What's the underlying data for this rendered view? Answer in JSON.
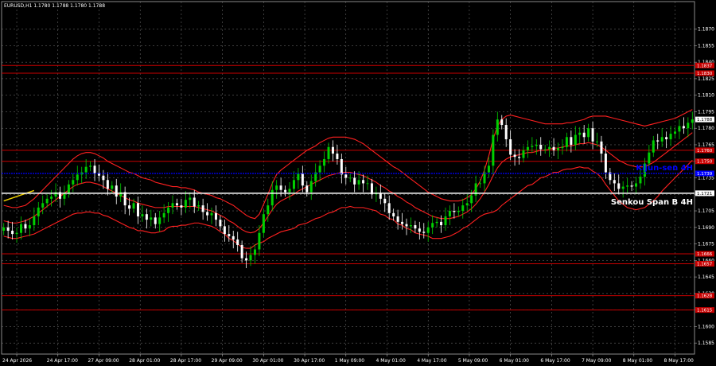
{
  "chart_data": {
    "type": "line",
    "symbol_header": "EURUSD,H1  1.1780 1.1788 1.1780 1.1788",
    "ylim": [
      1.1575,
      1.1895
    ],
    "y_ticks": [
      1.1585,
      1.16,
      1.1615,
      1.163,
      1.1645,
      1.166,
      1.1675,
      1.169,
      1.1705,
      1.172,
      1.1735,
      1.175,
      1.1765,
      1.178,
      1.1795,
      1.181,
      1.1825,
      1.184,
      1.1855,
      1.187
    ],
    "x_ticks": [
      "24 Apr 2026",
      "24 Apr 17:00",
      "27 Apr 09:00",
      "28 Apr 01:00",
      "28 Apr 17:00",
      "29 Apr 09:00",
      "30 Apr 01:00",
      "30 Apr 17:00",
      "1 May 09:00",
      "4 May 01:00",
      "4 May 17:00",
      "5 May 09:00",
      "6 May 01:00",
      "6 May 17:00",
      "7 May 09:00",
      "8 May 01:00",
      "8 May 17:00"
    ],
    "bars_count": 160,
    "last_price": 1.1788,
    "colors": {
      "bull": "#00d000",
      "bear": "#ffffff",
      "band": "#ff2020",
      "level": "#c80000",
      "kijun": "#0000ff",
      "senkou": "#ffffff",
      "trend": "#f0d000",
      "grid": "#7a7a7a"
    },
    "series": [
      {
        "name": "Close",
        "values": [
          1.169,
          1.1687,
          1.1684,
          1.1685,
          1.1693,
          1.1689,
          1.1692,
          1.17,
          1.1708,
          1.1712,
          1.1716,
          1.1718,
          1.1722,
          1.1716,
          1.1721,
          1.1729,
          1.1733,
          1.1738,
          1.174,
          1.1745,
          1.1746,
          1.1739,
          1.1737,
          1.1733,
          1.1725,
          1.1728,
          1.1718,
          1.1722,
          1.171,
          1.1707,
          1.1712,
          1.17,
          1.1702,
          1.1697,
          1.1699,
          1.1693,
          1.1699,
          1.1703,
          1.1708,
          1.1712,
          1.171,
          1.1708,
          1.1715,
          1.1717,
          1.1709,
          1.171,
          1.1704,
          1.1701,
          1.1703,
          1.1697,
          1.1691,
          1.1684,
          1.1682,
          1.1679,
          1.1674,
          1.1662,
          1.166,
          1.1665,
          1.167,
          1.1685,
          1.1702,
          1.171,
          1.1724,
          1.1728,
          1.1724,
          1.1722,
          1.1725,
          1.1733,
          1.1739,
          1.1728,
          1.1722,
          1.1732,
          1.174,
          1.1746,
          1.1752,
          1.1763,
          1.1757,
          1.1752,
          1.1738,
          1.1735,
          1.1735,
          1.1729,
          1.1733,
          1.173,
          1.173,
          1.172,
          1.1721,
          1.1716,
          1.1712,
          1.1703,
          1.17,
          1.1695,
          1.1693,
          1.1691,
          1.1692,
          1.1689,
          1.1686,
          1.1685,
          1.169,
          1.1694,
          1.1695,
          1.1692,
          1.17,
          1.1705,
          1.1704,
          1.1705,
          1.171,
          1.1712,
          1.1719,
          1.173,
          1.173,
          1.174,
          1.1746,
          1.1774,
          1.1788,
          1.1783,
          1.177,
          1.1756,
          1.1754,
          1.1753,
          1.176,
          1.1763,
          1.1764,
          1.1765,
          1.1761,
          1.1761,
          1.1763,
          1.176,
          1.1762,
          1.1763,
          1.1772,
          1.1765,
          1.1774,
          1.1776,
          1.1772,
          1.178,
          1.1768,
          1.1768,
          1.1757,
          1.174,
          1.1733,
          1.173,
          1.1725,
          1.1727,
          1.1728,
          1.1727,
          1.173,
          1.1736,
          1.1748,
          1.1758,
          1.1769,
          1.1768,
          1.1772,
          1.177,
          1.1775,
          1.1777,
          1.1782,
          1.178,
          1.1785,
          1.1788
        ]
      },
      {
        "name": "Upper Band",
        "values": [
          1.171,
          1.1709,
          1.1708,
          1.1708,
          1.1709,
          1.171,
          1.1713,
          1.1716,
          1.172,
          1.1724,
          1.1728,
          1.1732,
          1.1736,
          1.174,
          1.1744,
          1.1748,
          1.1752,
          1.1755,
          1.1757,
          1.1758,
          1.1758,
          1.1757,
          1.1755,
          1.1753,
          1.175,
          1.1748,
          1.1746,
          1.1744,
          1.1742,
          1.174,
          1.1739,
          1.1737,
          1.1735,
          1.1734,
          1.1733,
          1.1731,
          1.173,
          1.1729,
          1.1728,
          1.1727,
          1.1727,
          1.1726,
          1.1726,
          1.1725,
          1.1724,
          1.1722,
          1.1721,
          1.172,
          1.1719,
          1.1717,
          1.1716,
          1.1714,
          1.1712,
          1.171,
          1.1707,
          1.1704,
          1.1701,
          1.1699,
          1.1698,
          1.1702,
          1.1711,
          1.172,
          1.173,
          1.1738,
          1.1742,
          1.1745,
          1.1748,
          1.1751,
          1.1754,
          1.1757,
          1.176,
          1.1762,
          1.1764,
          1.1767,
          1.1769,
          1.1771,
          1.1772,
          1.1772,
          1.1772,
          1.1772,
          1.1771,
          1.177,
          1.1768,
          1.1766,
          1.1763,
          1.176,
          1.1757,
          1.1754,
          1.1751,
          1.1748,
          1.1745,
          1.1743,
          1.174,
          1.1737,
          1.1734,
          1.1731,
          1.1728,
          1.1725,
          1.1722,
          1.172,
          1.1718,
          1.1716,
          1.1715,
          1.1714,
          1.1714,
          1.1714,
          1.1715,
          1.1717,
          1.172,
          1.1725,
          1.1732,
          1.1742,
          1.1755,
          1.177,
          1.1782,
          1.1788,
          1.1791,
          1.1792,
          1.1791,
          1.179,
          1.1789,
          1.1788,
          1.1787,
          1.1786,
          1.1785,
          1.1784,
          1.1784,
          1.1784,
          1.1784,
          1.1784,
          1.1785,
          1.1785,
          1.1786,
          1.1787,
          1.1788,
          1.179,
          1.1791,
          1.1791,
          1.1791,
          1.1791,
          1.179,
          1.1789,
          1.1788,
          1.1787,
          1.1786,
          1.1785,
          1.1784,
          1.1783,
          1.1782,
          1.1783,
          1.1784,
          1.1785,
          1.1786,
          1.1787,
          1.1788,
          1.1789,
          1.1791,
          1.1793,
          1.1795,
          1.1797
        ]
      },
      {
        "name": "Middle Band",
        "values": [
          1.1696,
          1.1695,
          1.1694,
          1.1694,
          1.1695,
          1.1696,
          1.1698,
          1.17,
          1.1703,
          1.1706,
          1.1709,
          1.1712,
          1.1715,
          1.1718,
          1.1721,
          1.1724,
          1.1727,
          1.1729,
          1.173,
          1.1731,
          1.1731,
          1.173,
          1.1729,
          1.1727,
          1.1725,
          1.1723,
          1.1721,
          1.1719,
          1.1717,
          1.1715,
          1.1714,
          1.1712,
          1.1711,
          1.171,
          1.1709,
          1.1708,
          1.1708,
          1.1708,
          1.1709,
          1.1709,
          1.1709,
          1.1709,
          1.1709,
          1.1709,
          1.1709,
          1.1708,
          1.1707,
          1.1706,
          1.1705,
          1.1703,
          1.1701,
          1.1699,
          1.1696,
          1.1694,
          1.1691,
          1.1688,
          1.1686,
          1.1685,
          1.1686,
          1.1689,
          1.1694,
          1.17,
          1.1706,
          1.1711,
          1.1714,
          1.1716,
          1.1718,
          1.172,
          1.1723,
          1.1725,
          1.1727,
          1.1729,
          1.1731,
          1.1733,
          1.1735,
          1.1737,
          1.1738,
          1.1739,
          1.174,
          1.174,
          1.174,
          1.1739,
          1.1738,
          1.1737,
          1.1735,
          1.1733,
          1.1731,
          1.1728,
          1.1726,
          1.1723,
          1.1721,
          1.1718,
          1.1716,
          1.1713,
          1.1711,
          1.1708,
          1.1706,
          1.1704,
          1.1702,
          1.17,
          1.1699,
          1.1698,
          1.1698,
          1.1698,
          1.1699,
          1.17,
          1.1702,
          1.1704,
          1.1707,
          1.1711,
          1.1716,
          1.1722,
          1.1729,
          1.1737,
          1.1744,
          1.1749,
          1.1752,
          1.1754,
          1.1755,
          1.1756,
          1.1757,
          1.1758,
          1.1758,
          1.1759,
          1.176,
          1.176,
          1.1761,
          1.1762,
          1.1762,
          1.1763,
          1.1764,
          1.1764,
          1.1765,
          1.1766,
          1.1766,
          1.1767,
          1.1766,
          1.1765,
          1.1763,
          1.176,
          1.1757,
          1.1754,
          1.1751,
          1.1749,
          1.1747,
          1.1746,
          1.1745,
          1.1745,
          1.1745,
          1.1747,
          1.1749,
          1.1752,
          1.1755,
          1.1758,
          1.1761,
          1.1764,
          1.1767,
          1.177,
          1.1773,
          1.1776
        ]
      },
      {
        "name": "Lower Band",
        "values": [
          1.1682,
          1.1681,
          1.168,
          1.168,
          1.1681,
          1.1682,
          1.1683,
          1.1684,
          1.1686,
          1.1688,
          1.169,
          1.1692,
          1.1694,
          1.1696,
          1.1698,
          1.17,
          1.1702,
          1.1703,
          1.1703,
          1.1704,
          1.1704,
          1.1703,
          1.1703,
          1.1701,
          1.17,
          1.1698,
          1.1696,
          1.1694,
          1.1692,
          1.169,
          1.1689,
          1.1687,
          1.1687,
          1.1686,
          1.1685,
          1.1685,
          1.1686,
          1.1687,
          1.169,
          1.1691,
          1.1691,
          1.1692,
          1.1692,
          1.1693,
          1.1694,
          1.1694,
          1.1693,
          1.1692,
          1.1691,
          1.1689,
          1.1686,
          1.1684,
          1.168,
          1.1678,
          1.1675,
          1.1672,
          1.1671,
          1.1671,
          1.1674,
          1.1676,
          1.1677,
          1.168,
          1.1682,
          1.1684,
          1.1686,
          1.1687,
          1.1688,
          1.1689,
          1.1692,
          1.1693,
          1.1694,
          1.1696,
          1.1698,
          1.1699,
          1.1701,
          1.1703,
          1.1704,
          1.1706,
          1.1708,
          1.1708,
          1.1709,
          1.1708,
          1.1708,
          1.1708,
          1.1707,
          1.1706,
          1.1705,
          1.1702,
          1.1701,
          1.1698,
          1.1697,
          1.1693,
          1.1692,
          1.1689,
          1.1688,
          1.1685,
          1.1684,
          1.1683,
          1.1682,
          1.168,
          1.168,
          1.168,
          1.1681,
          1.1682,
          1.1684,
          1.1686,
          1.1689,
          1.1691,
          1.1694,
          1.1697,
          1.17,
          1.1702,
          1.1703,
          1.1704,
          1.1706,
          1.171,
          1.1713,
          1.1716,
          1.1719,
          1.1722,
          1.1725,
          1.1728,
          1.1729,
          1.1732,
          1.1735,
          1.1736,
          1.1738,
          1.174,
          1.174,
          1.1742,
          1.1743,
          1.1743,
          1.1744,
          1.1745,
          1.1744,
          1.1744,
          1.1741,
          1.1739,
          1.1735,
          1.1729,
          1.1724,
          1.1719,
          1.1714,
          1.1711,
          1.1708,
          1.1707,
          1.1706,
          1.1707,
          1.1708,
          1.1711,
          1.1714,
          1.1718,
          1.1723,
          1.1727,
          1.1731,
          1.1735,
          1.1739,
          1.1743,
          1.1747,
          1.1751
        ]
      }
    ],
    "levels": [
      {
        "label": "1.1837",
        "value": 1.1837
      },
      {
        "label": "1.1830",
        "value": 1.183
      },
      {
        "label": "1.1760",
        "value": 1.176
      },
      {
        "label": "1.1750",
        "value": 1.175
      },
      {
        "label": "1.1666",
        "value": 1.1666
      },
      {
        "label": "1.1657",
        "value": 1.1657
      },
      {
        "label": "1.1628",
        "value": 1.1628
      },
      {
        "label": "1.1615",
        "value": 1.1615
      }
    ],
    "kijun": {
      "label": "Kijun-sen 4H",
      "value": 1.1739
    },
    "senkou": {
      "label": "Senkou Span B 4H",
      "value": 1.1721
    }
  }
}
